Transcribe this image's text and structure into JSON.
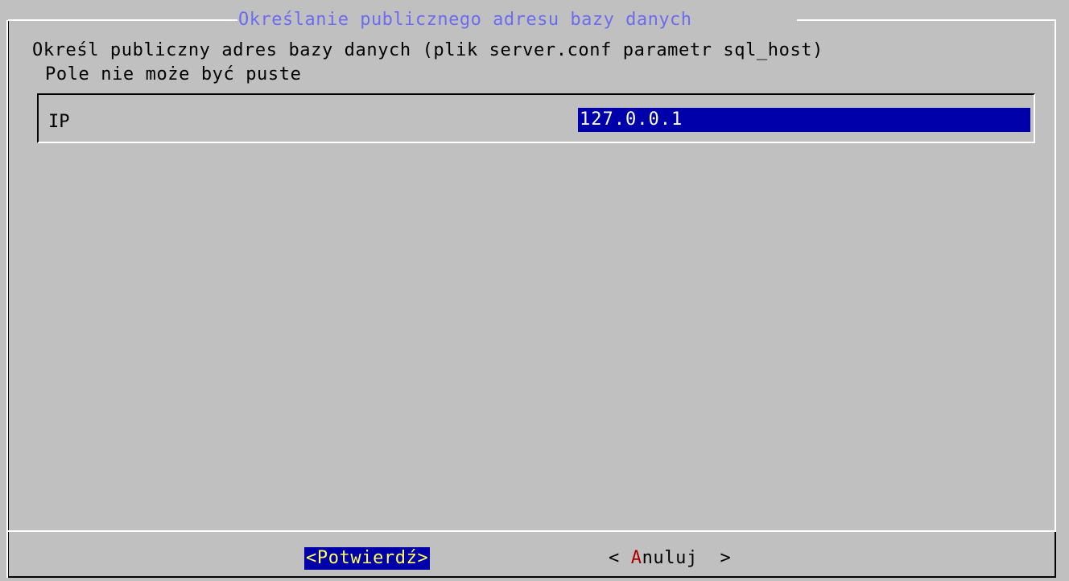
{
  "dialog": {
    "title": "Określanie publicznego adresu bazy danych",
    "description_line1": "Określ publiczny adres bazy danych (plik server.conf parametr sql_host)",
    "description_line2": "Pole nie może być puste"
  },
  "form": {
    "field_label": "IP",
    "field_value": "127.0.0.1"
  },
  "buttons": {
    "confirm_label": "<Potwierdź>",
    "cancel_prefix": "< ",
    "cancel_hotkey": "A",
    "cancel_rest": "nuluj",
    "cancel_suffix": "  >"
  },
  "colors": {
    "background": "#c0c0c0",
    "title": "#6c6cf0",
    "highlight": "#0000aa",
    "button_active_text": "#ffff55",
    "hotkey": "#aa0000"
  }
}
